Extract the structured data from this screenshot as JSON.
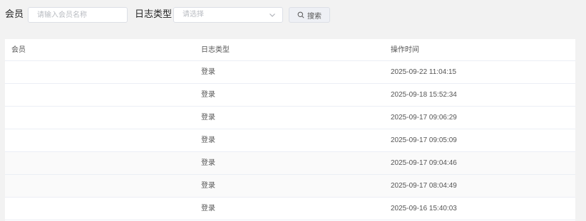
{
  "filters": {
    "member_label": "会员",
    "member_placeholder": "请输入会员名称",
    "log_type_label": "日志类型",
    "log_type_placeholder": "请选择",
    "search_label": "搜索"
  },
  "table": {
    "columns": [
      "会员",
      "日志类型",
      "操作时间"
    ],
    "rows": [
      {
        "member": "",
        "type": "登录",
        "time": "2025-09-22 11:04:15"
      },
      {
        "member": "",
        "type": "登录",
        "time": "2025-09-18 15:52:34"
      },
      {
        "member": "",
        "type": "登录",
        "time": "2025-09-17 09:06:29"
      },
      {
        "member": "",
        "type": "登录",
        "time": "2025-09-17 09:05:09"
      },
      {
        "member": "",
        "type": "登录",
        "time": "2025-09-17 09:04:46"
      },
      {
        "member": "",
        "type": "登录",
        "time": "2025-09-17 08:04:49"
      },
      {
        "member": "",
        "type": "登录",
        "time": "2025-09-16 15:40:03"
      }
    ]
  },
  "icons": {
    "select_arrow": "chevron-down-icon",
    "search": "search-icon"
  }
}
